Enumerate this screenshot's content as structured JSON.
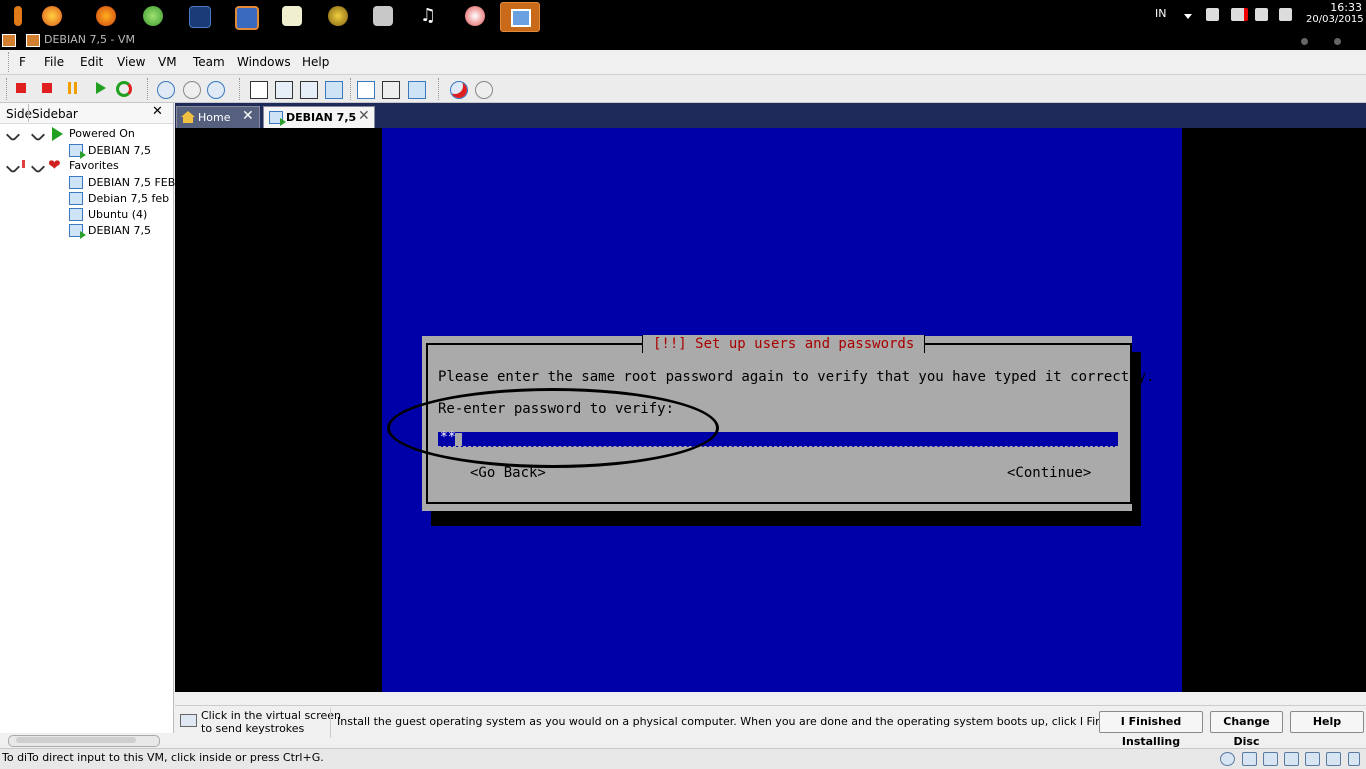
{
  "window": {
    "title": "DEBIAN 7,5 - VM"
  },
  "taskbar": {
    "language": "IN",
    "clock_time": "16:33",
    "clock_date": "20/03/2015"
  },
  "menubar": {
    "items": [
      "F",
      "File",
      "Edit",
      "View",
      "VM",
      "Team",
      "Windows",
      "Help"
    ]
  },
  "sidebar": {
    "tab_label": "Side",
    "title": "Sidebar",
    "close_glyph": "✕",
    "groups": [
      {
        "label": "Powered On",
        "items": [
          "DEBIAN 7,5"
        ]
      },
      {
        "label": "Favorites",
        "items": [
          "DEBIAN 7,5 FEB",
          "Debian 7,5 feb",
          "Ubuntu (4)",
          "DEBIAN 7,5"
        ]
      }
    ]
  },
  "tabs": [
    {
      "label": "Home",
      "close": "✕"
    },
    {
      "label": "DEBIAN 7,5",
      "close": "✕"
    }
  ],
  "installer": {
    "title": "[!!] Set up users and passwords",
    "prompt": "Please enter the same root password again to verify that you have typed it correctly.",
    "label": "Re-enter password to verify:",
    "password_value": "**",
    "back_button": "<Go Back>",
    "continue_button": "<Continue>"
  },
  "hintbar": {
    "click_hint_line1": "Click in the virtual screen",
    "click_hint_line2": "to send keystrokes",
    "install_hint": "Install the guest operating system as you would on a physical computer. When you are done and the operating system boots up, click I Finished Installing.",
    "finished_button": "I Finished Installing",
    "change_disc_button": "Change Disc",
    "help_button": "Help"
  },
  "status": {
    "text": "To diTo direct input to this VM, click inside or press Ctrl+G."
  },
  "colors": {
    "installer_blue": "#0000a8",
    "dialog_gray": "#aaaaaa",
    "title_red": "#a80000",
    "taskbar": "#000000"
  }
}
